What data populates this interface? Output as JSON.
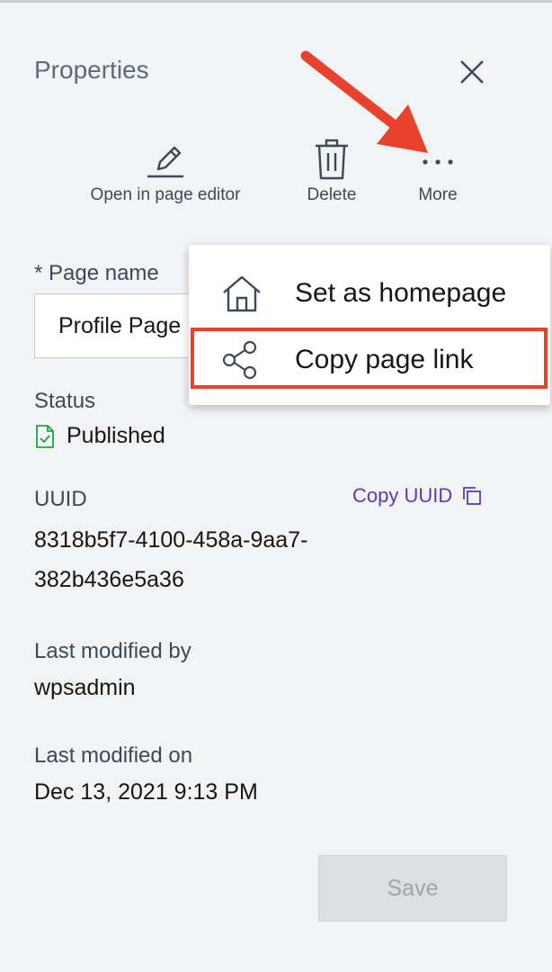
{
  "panel": {
    "title": "Properties",
    "toolbar": {
      "open_editor_label": "Open in page editor",
      "delete_label": "Delete",
      "more_label": "More"
    },
    "page_name": {
      "label": "* Page name",
      "value": "Profile Page"
    },
    "status": {
      "label": "Status",
      "value": "Published"
    },
    "uuid": {
      "label": "UUID",
      "copy_label": "Copy UUID",
      "value_line1": "8318b5f7-4100-458a-9aa7-",
      "value_line2": "382b436e5a36"
    },
    "last_modified_by": {
      "label": "Last modified by",
      "value": "wpsadmin"
    },
    "last_modified_on": {
      "label": "Last modified on",
      "value": "Dec 13, 2021 9:13 PM"
    },
    "save_label": "Save"
  },
  "more_menu": {
    "items": [
      {
        "label": "Set as homepage",
        "icon": "home-icon"
      },
      {
        "label": "Copy page link",
        "icon": "share-icon"
      }
    ]
  },
  "colors": {
    "background": "#f2f3f5",
    "annotation": "#e8412c",
    "link": "#5b3fa8",
    "status_icon": "#24a148"
  }
}
